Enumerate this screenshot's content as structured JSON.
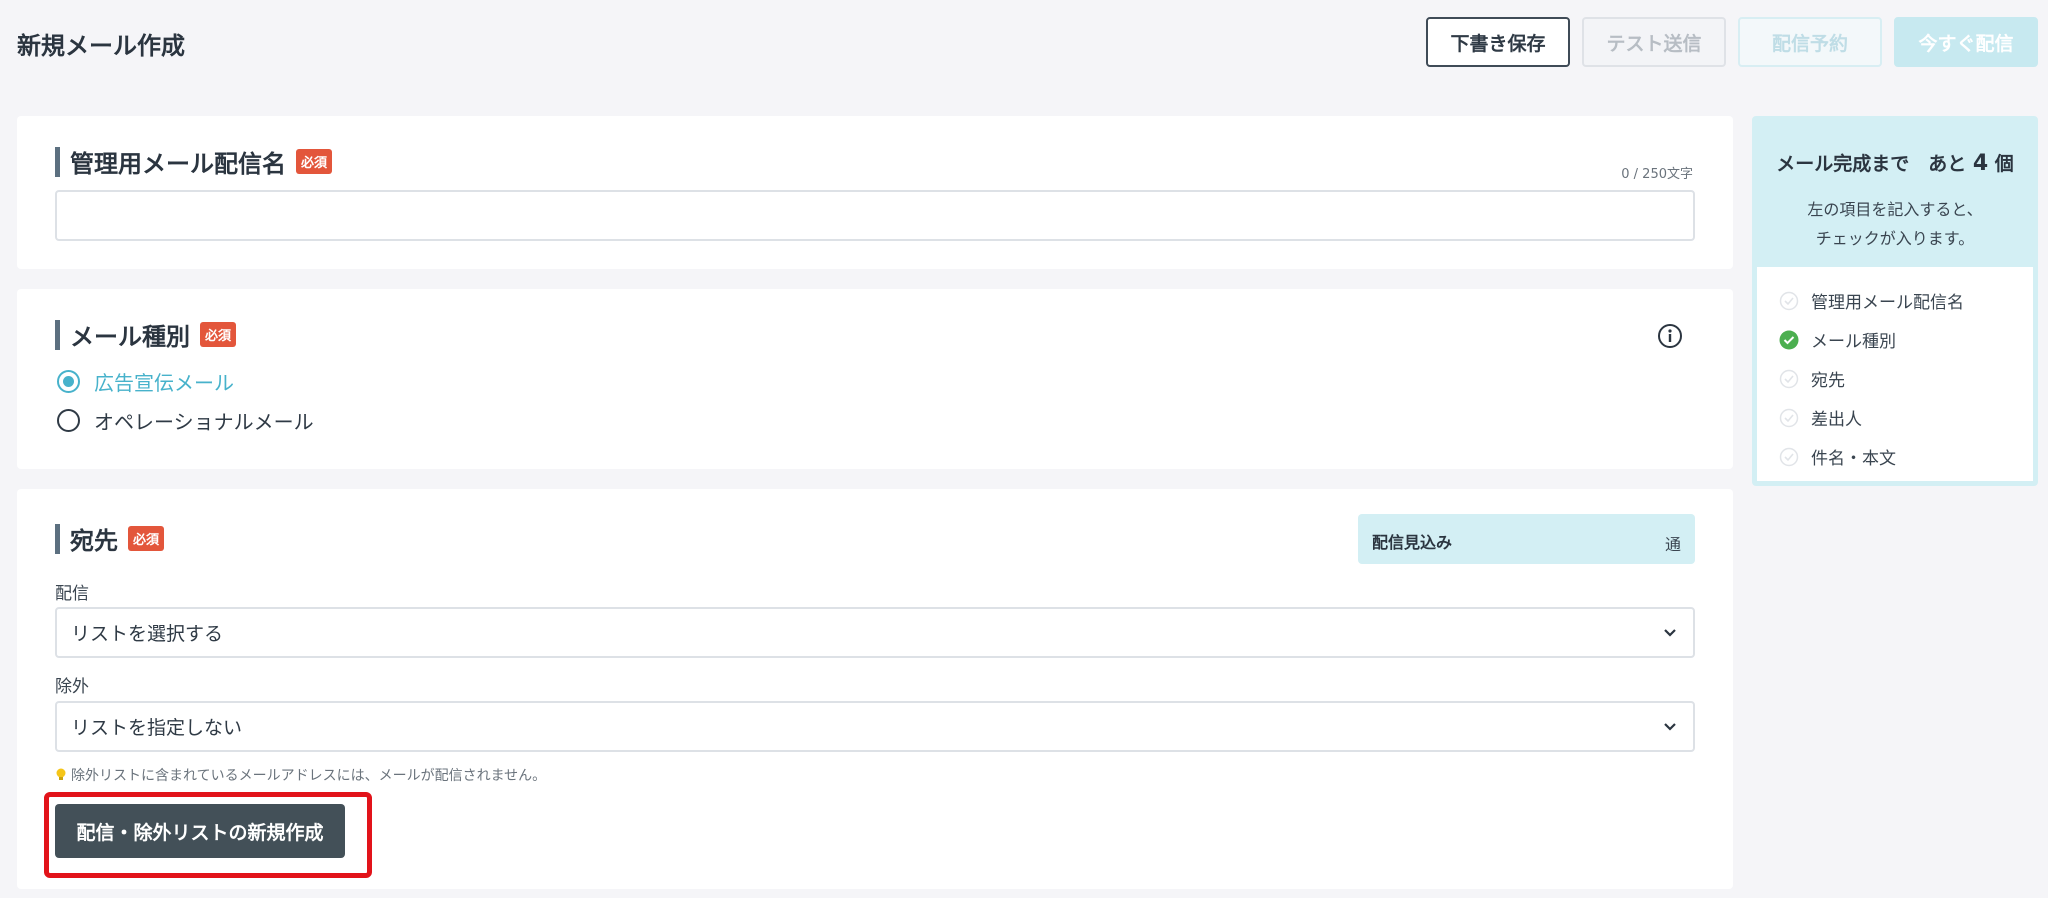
{
  "header": {
    "title": "新規メール作成",
    "buttons": {
      "draft": "下書き保存",
      "test": "テスト送信",
      "schedule": "配信予約",
      "send_now": "今すぐ配信"
    }
  },
  "required_badge": "必須",
  "name_section": {
    "title": "管理用メール配信名",
    "counter": "0 / 250文字",
    "value": ""
  },
  "type_section": {
    "title": "メール種別",
    "options": [
      {
        "label": "広告宣伝メール",
        "selected": true
      },
      {
        "label": "オペレーショナルメール",
        "selected": false
      }
    ]
  },
  "recipient_section": {
    "title": "宛先",
    "estimate_label": "配信見込み",
    "estimate_unit": "通",
    "deliver_label": "配信",
    "deliver_value": "リストを選択する",
    "exclude_label": "除外",
    "exclude_value": "リストを指定しない",
    "hint": "除外リストに含まれているメールアドレスには、メールが配信されません。",
    "create_button": "配信・除外リストの新規作成"
  },
  "progress_panel": {
    "title_prefix": "メール完成まで　あと",
    "remaining": "4",
    "title_suffix": "個",
    "desc_line1": "左の項目を記入すると、",
    "desc_line2": "チェックが入ります。",
    "items": [
      {
        "label": "管理用メール配信名",
        "done": false
      },
      {
        "label": "メール種別",
        "done": true
      },
      {
        "label": "宛先",
        "done": false
      },
      {
        "label": "差出人",
        "done": false
      },
      {
        "label": "件名・本文",
        "done": false
      }
    ]
  },
  "colors": {
    "accent": "#47b2cb",
    "required": "#e3563b",
    "check_done": "#4caf50",
    "highlight": "#e2131a"
  }
}
